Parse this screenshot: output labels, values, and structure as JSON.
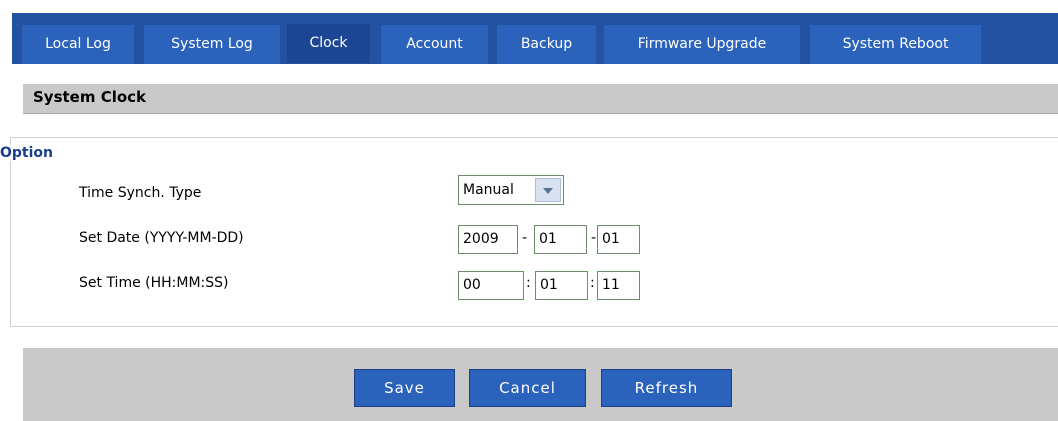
{
  "tabs": [
    {
      "label": "Local Log"
    },
    {
      "label": "System Log"
    },
    {
      "label": "Clock",
      "active": true
    },
    {
      "label": "Account"
    },
    {
      "label": "Backup"
    },
    {
      "label": "Firmware Upgrade"
    },
    {
      "label": "System Reboot"
    }
  ],
  "section": {
    "title": "System Clock"
  },
  "option": {
    "label": "Option",
    "rows": {
      "sync_type": {
        "label": "Time Synch. Type",
        "value": "Manual"
      },
      "date": {
        "label": "Set Date (YYYY-MM-DD)",
        "year": "2009",
        "month": "01",
        "day": "01",
        "separator": "-"
      },
      "time": {
        "label": "Set Time (HH:MM:SS)",
        "hour": "00",
        "minute": "01",
        "second": "11",
        "separator": ":"
      }
    }
  },
  "buttons": {
    "save": "Save",
    "cancel": "Cancel",
    "refresh": "Refresh"
  },
  "colors": {
    "tab_bg": "#2b62bb",
    "tab_active": "#1c4694",
    "header_gray": "#c9c9c9",
    "option_blue": "#1b3e8c"
  }
}
